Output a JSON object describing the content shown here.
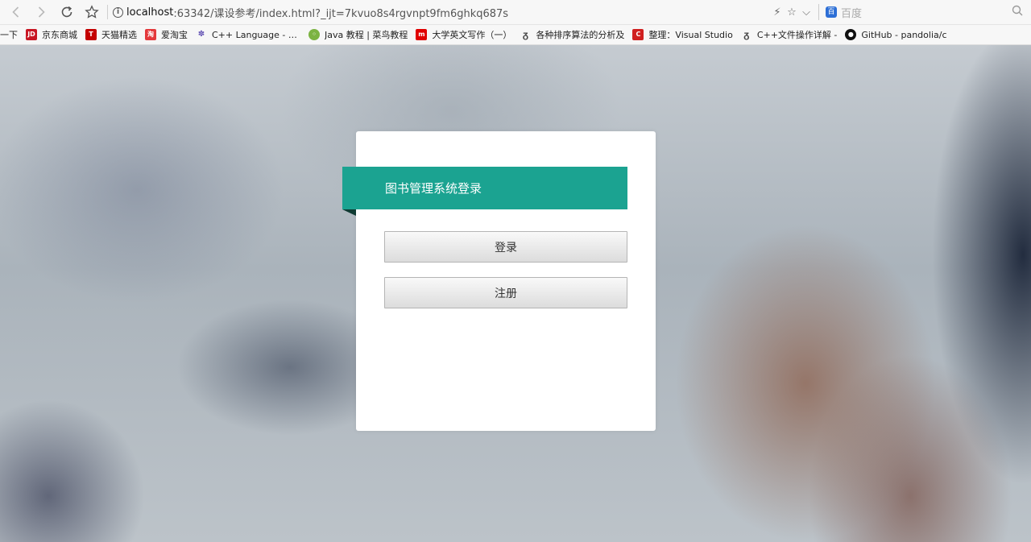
{
  "browser": {
    "url_host": "localhost",
    "url_rest": ":63342/课设参考/index.html?_ijt=7kvuo8s4rgvnpt9fm6ghkq687s",
    "search_placeholder": "百度"
  },
  "bookmarks": [
    {
      "label": "一下",
      "icon": "none",
      "color": ""
    },
    {
      "label": "京东商城",
      "icon": "JD",
      "color": "#c81623"
    },
    {
      "label": "天猫精选",
      "icon": "T",
      "color": "#c40000"
    },
    {
      "label": "爱淘宝",
      "icon": "淘",
      "color": "#e4393c"
    },
    {
      "label": "C++ Language - C+",
      "icon": "cpp",
      "color": "#6b5bb8"
    },
    {
      "label": "Java 教程 | 菜鸟教程",
      "icon": "runoob",
      "color": "#7cb342"
    },
    {
      "label": "大学英文写作（一）",
      "icon": "m",
      "color": "#e00000"
    },
    {
      "label": "各种排序算法的分析及",
      "icon": "leaf",
      "color": "#444444"
    },
    {
      "label": "整理：Visual Studio",
      "icon": "C",
      "color": "#d02020"
    },
    {
      "label": "C++文件操作详解 -",
      "icon": "leaf",
      "color": "#444444"
    },
    {
      "label": "GitHub - pandolia/c",
      "icon": "github",
      "color": "#111111"
    }
  ],
  "login": {
    "title": "图书管理系统登录",
    "login_label": "登录",
    "register_label": "注册"
  },
  "colors": {
    "accent": "#1ba391"
  }
}
